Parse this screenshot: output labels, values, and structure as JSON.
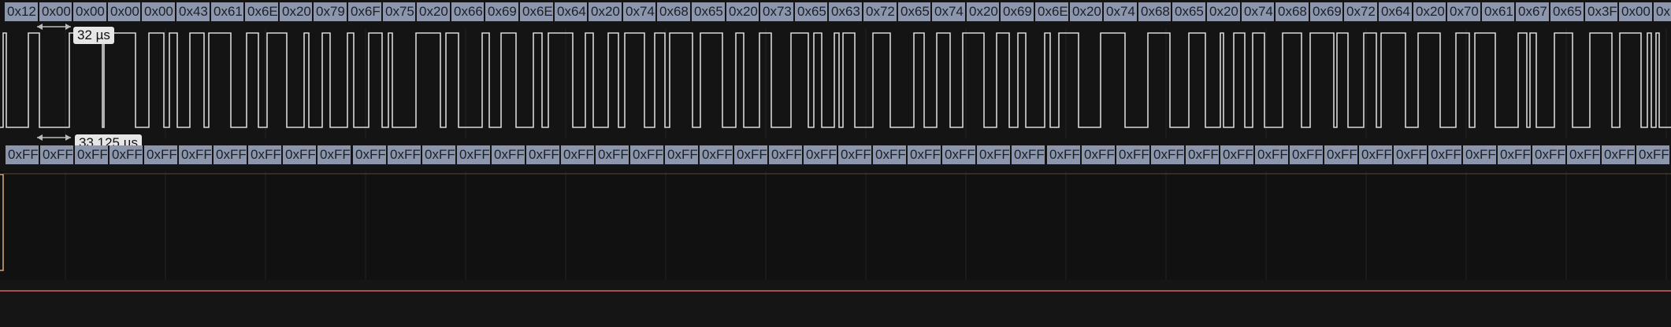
{
  "decoder_top": {
    "bytes": [
      "0x12",
      "0x00",
      "0x00",
      "0x00",
      "0x00",
      "0x43",
      "0x61",
      "0x6E",
      "0x20",
      "0x79",
      "0x6F",
      "0x75",
      "0x20",
      "0x66",
      "0x69",
      "0x6E",
      "0x64",
      "0x20",
      "0x74",
      "0x68",
      "0x65",
      "0x20",
      "0x73",
      "0x65",
      "0x63",
      "0x72",
      "0x65",
      "0x74",
      "0x20",
      "0x69",
      "0x6E",
      "0x20",
      "0x74",
      "0x68",
      "0x65",
      "0x20",
      "0x74",
      "0x68",
      "0x69",
      "0x72",
      "0x64",
      "0x20",
      "0x70",
      "0x61",
      "0x67",
      "0x65",
      "0x3F",
      "0x00",
      "0x"
    ]
  },
  "decoder_bottom": {
    "bytes": [
      "0xFF",
      "0xFF",
      "0xFF",
      "0xFF",
      "0xFF",
      "0xFF",
      "0xFF",
      "0xFF",
      "0xFF",
      "0xFF",
      "0xFF",
      "0xFF",
      "0xFF",
      "0xFF",
      "0xFF",
      "0xFF",
      "0xFF",
      "0xFF",
      "0xFF",
      "0xFF",
      "0xFF",
      "0xFF",
      "0xFF",
      "0xFF",
      "0xFF",
      "0xFF",
      "0xFF",
      "0xFF",
      "0xFF",
      "0xFF",
      "0xFF",
      "0xFF",
      "0xFF",
      "0xFF",
      "0xFF",
      "0xFF",
      "0xFF",
      "0xFF",
      "0xFF",
      "0xFF",
      "0xFF",
      "0xFF",
      "0xFF",
      "0xFF",
      "0xFF",
      "0xFF",
      "0xFF",
      "0xFF"
    ]
  },
  "measurements": {
    "period_label": "32 µs",
    "width_label": "33.125 µs"
  },
  "colors": {
    "background": "#141414",
    "decode_fill": "#8c97ad",
    "decode_text": "#1c1f26",
    "waveform": "#d8d8d8",
    "analog_trace": "#c9a27a",
    "threshold_line": "#d9656b",
    "badge_bg": "#e6e6e6"
  }
}
